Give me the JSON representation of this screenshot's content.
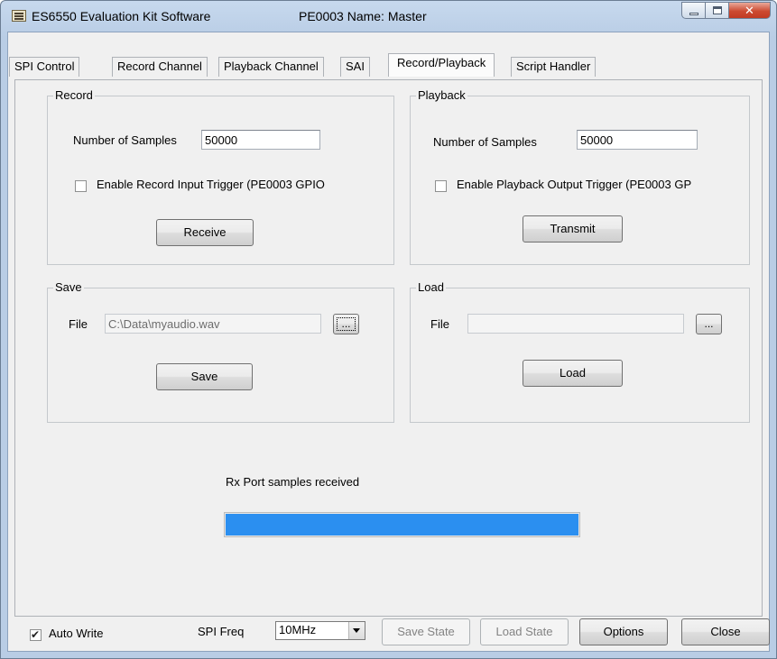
{
  "window": {
    "app_title": "ES6550 Evaluation Kit Software",
    "device_title": "PE0003 Name: Master"
  },
  "tabs": [
    {
      "label": "SPI Control"
    },
    {
      "label": "Record Channel"
    },
    {
      "label": "Playback Channel"
    },
    {
      "label": "SAI"
    },
    {
      "label": "Record/Playback"
    },
    {
      "label": "Script Handler"
    }
  ],
  "active_tab": "Record/Playback",
  "record": {
    "title": "Record",
    "samples_label": "Number of Samples",
    "samples_value": "50000",
    "trigger_label": "Enable Record Input Trigger (PE0003 GPIO",
    "trigger_checked": false,
    "receive_button": "Receive"
  },
  "playback": {
    "title": "Playback",
    "samples_label": "Number of Samples",
    "samples_value": "50000",
    "trigger_label": "Enable Playback Output Trigger (PE0003 GP",
    "trigger_checked": false,
    "transmit_button": "Transmit"
  },
  "save": {
    "title": "Save",
    "file_label": "File",
    "file_value": "C:\\Data\\myaudio.wav",
    "browse_button": "...",
    "save_button": "Save"
  },
  "load": {
    "title": "Load",
    "file_label": "File",
    "file_value": "",
    "browse_button": "...",
    "load_button": "Load"
  },
  "progress": {
    "label": "Rx Port samples received",
    "fill_fraction": 1.0,
    "color": "#2b8ff0"
  },
  "footer": {
    "auto_write_label": "Auto Write",
    "auto_write_checked": true,
    "spi_freq_label": "SPI Freq",
    "spi_freq_value": "10MHz",
    "save_state_button": "Save State",
    "load_state_button": "Load State",
    "options_button": "Options",
    "close_button": "Close"
  }
}
